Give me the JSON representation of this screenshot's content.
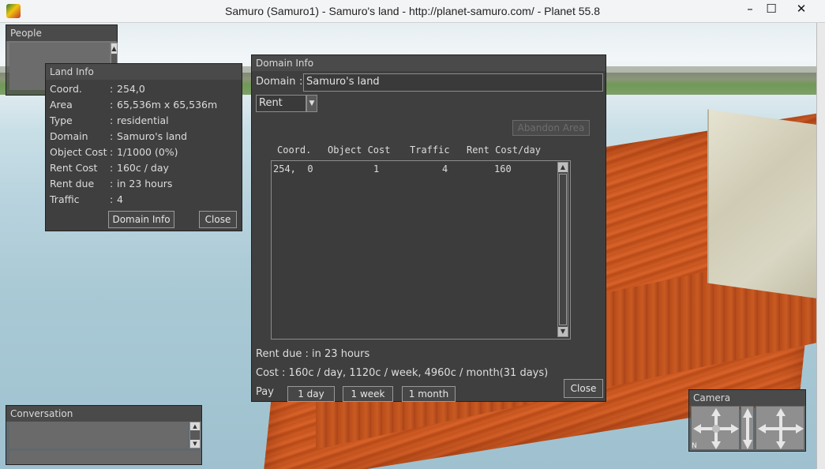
{
  "window": {
    "title": "Samuro (Samuro1) - Samuro's land - http://planet-samuro.com/ - Planet 55.8",
    "min_glyph": "–",
    "max_glyph": "☐",
    "close_glyph": "✕"
  },
  "people": {
    "title": "People"
  },
  "land_info": {
    "title": "Land Info",
    "rows": [
      {
        "key": "Coord.",
        "value": "254,0"
      },
      {
        "key": "Area",
        "value": "65,536m x 65,536m"
      },
      {
        "key": "Type",
        "value": "residential"
      },
      {
        "key": "Domain",
        "value": "Samuro's land"
      },
      {
        "key": "Object Cost",
        "value": "1/1000 (0%)"
      },
      {
        "key": "Rent Cost",
        "value": "160c / day"
      },
      {
        "key": "Rent due",
        "value": "in 23 hours"
      },
      {
        "key": "Traffic",
        "value": "4"
      }
    ],
    "colon": ":",
    "domain_info_button": "Domain Info",
    "close_button": "Close"
  },
  "domain_info": {
    "title": "Domain Info",
    "domain_label": "Domain",
    "domain_colon": ":",
    "domain_value": "Samuro's land",
    "mode_select": "Rent",
    "abandon_button": "Abandon Area",
    "columns": [
      "Coord.",
      "Object Cost",
      "Traffic",
      "Rent Cost/day"
    ],
    "rows": [
      {
        "coord": "254,  0",
        "object_cost": "1",
        "traffic": "4",
        "rent_cost": "160"
      }
    ],
    "rent_due": "Rent due : in 23 hours",
    "cost": "Cost :  160c / day,  1120c / week,  4960c / month(31 days)",
    "pay_label": "Pay",
    "pay_buttons": [
      "1 day",
      "1 week",
      "1 month"
    ],
    "close_button": "Close"
  },
  "conversation": {
    "title": "Conversation"
  },
  "camera": {
    "title": "Camera",
    "corner_label": "N"
  }
}
